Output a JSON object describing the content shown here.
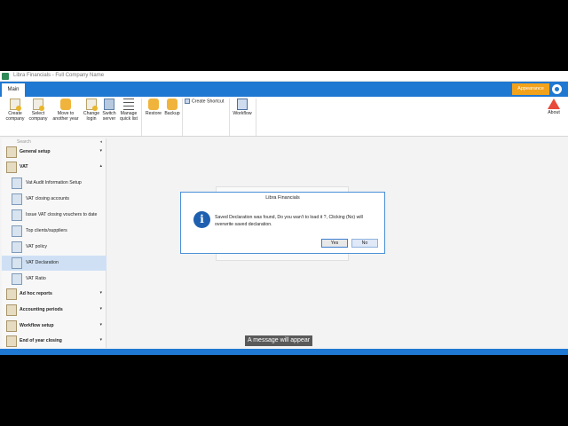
{
  "window": {
    "title": "Libra Financials - Full Company Name"
  },
  "tabs": {
    "main": "Main",
    "appearance": "Appearance"
  },
  "ribbon": {
    "create_company": "Create company",
    "select_company": "Select company",
    "move_year": "Move to another year",
    "change_login": "Change login",
    "switch_server": "Switch server",
    "manage_quick_list": "Manage quick list",
    "restore": "Restore",
    "backup": "Backup",
    "create_shortcut": "Create Shortcut",
    "workflow": "Workflow",
    "about": "About"
  },
  "sidebar": {
    "search_placeholder": "Search",
    "items": [
      {
        "label": "General setup",
        "group": true
      },
      {
        "label": "VAT",
        "group": true
      },
      {
        "label": "Vat Audit Information Setup"
      },
      {
        "label": "VAT closing accounts"
      },
      {
        "label": "Issue VAT closing vouchers to date"
      },
      {
        "label": "Top clients/suppliers"
      },
      {
        "label": "VAT policy"
      },
      {
        "label": "VAT Declaration",
        "selected": true
      },
      {
        "label": "VAT Ratio"
      },
      {
        "label": "Ad hoc reports",
        "group": true
      },
      {
        "label": "Accounting periods",
        "group": true
      },
      {
        "label": "Workflow setup",
        "group": true
      },
      {
        "label": "End of year closing",
        "group": true
      }
    ]
  },
  "dialog": {
    "title": "Libra Financials",
    "message": "Saved Declaration was found, Do you wan't to load it ?, Clicking (No) will overwrite saved declaration.",
    "yes": "Yes",
    "no": "No"
  },
  "caption": "A message will appear",
  "colors": {
    "accent": "#1f78d1",
    "appearance": "#f3a21b",
    "selected_row": "#cfe0f4"
  }
}
